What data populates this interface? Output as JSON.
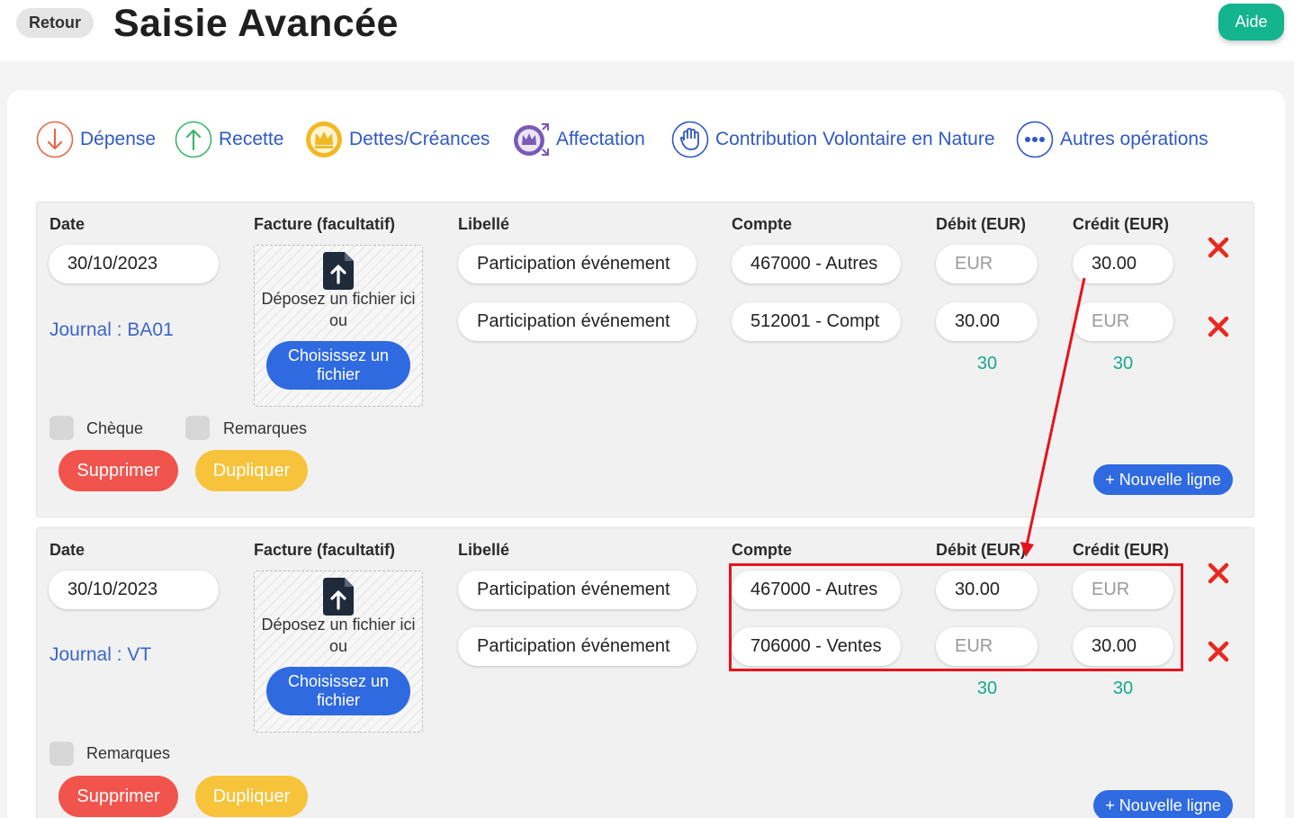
{
  "header": {
    "back_label": "Retour",
    "title": "Saisie Avancée",
    "help_label": "Aide"
  },
  "operation_types": [
    {
      "label": "Dépense",
      "icon": "arrow-down-icon",
      "color": "#e8674a"
    },
    {
      "label": "Recette",
      "icon": "arrow-up-icon",
      "color": "#3db56e"
    },
    {
      "label": "Dettes/Créances",
      "icon": "crown-icon",
      "color": "#f2b824"
    },
    {
      "label": "Affectation",
      "icon": "crown-arrows-icon",
      "color": "#7a5ab5"
    },
    {
      "label": "Contribution Volontaire en Nature",
      "icon": "hand-icon",
      "color": "#2f59c2"
    },
    {
      "label": "Autres opérations",
      "icon": "more-dots-icon",
      "color": "#2f59c2"
    }
  ],
  "columns": {
    "date": "Date",
    "invoice": "Facture (facultatif)",
    "label": "Libellé",
    "account": "Compte",
    "debit": "Débit (EUR)",
    "credit": "Crédit (EUR)"
  },
  "dropzone": {
    "text": "Déposez un fichier ici ou",
    "button": "Choisissez un fichier"
  },
  "placeholder_amount": "EUR",
  "entries": [
    {
      "date": "30/10/2023",
      "journal": "Journal : BA01",
      "lines": [
        {
          "label": "Participation événement",
          "account": "467000 - Autres",
          "debit": "",
          "credit": "30.00"
        },
        {
          "label": "Participation événement",
          "account": "512001 - Compt",
          "debit": "30.00",
          "credit": ""
        }
      ],
      "total_debit": "30",
      "total_credit": "30",
      "checkboxes": [
        "Chèque",
        "Remarques"
      ],
      "delete_label": "Supprimer",
      "duplicate_label": "Dupliquer",
      "new_line_label": "+ Nouvelle ligne"
    },
    {
      "date": "30/10/2023",
      "journal": "Journal : VT",
      "lines": [
        {
          "label": "Participation événement",
          "account": "467000 - Autres",
          "debit": "30.00",
          "credit": ""
        },
        {
          "label": "Participation événement",
          "account": "706000 - Ventes",
          "debit": "",
          "credit": "30.00"
        }
      ],
      "total_debit": "30",
      "total_credit": "30",
      "checkboxes": [
        "Remarques"
      ],
      "delete_label": "Supprimer",
      "duplicate_label": "Dupliquer",
      "new_line_label": "+ Nouvelle ligne"
    }
  ],
  "colors": {
    "primary": "#2f6ae0",
    "accent_green": "#13b48e",
    "danger": "#f0544c",
    "warning": "#f6c33a",
    "annotation": "#e8121b"
  }
}
